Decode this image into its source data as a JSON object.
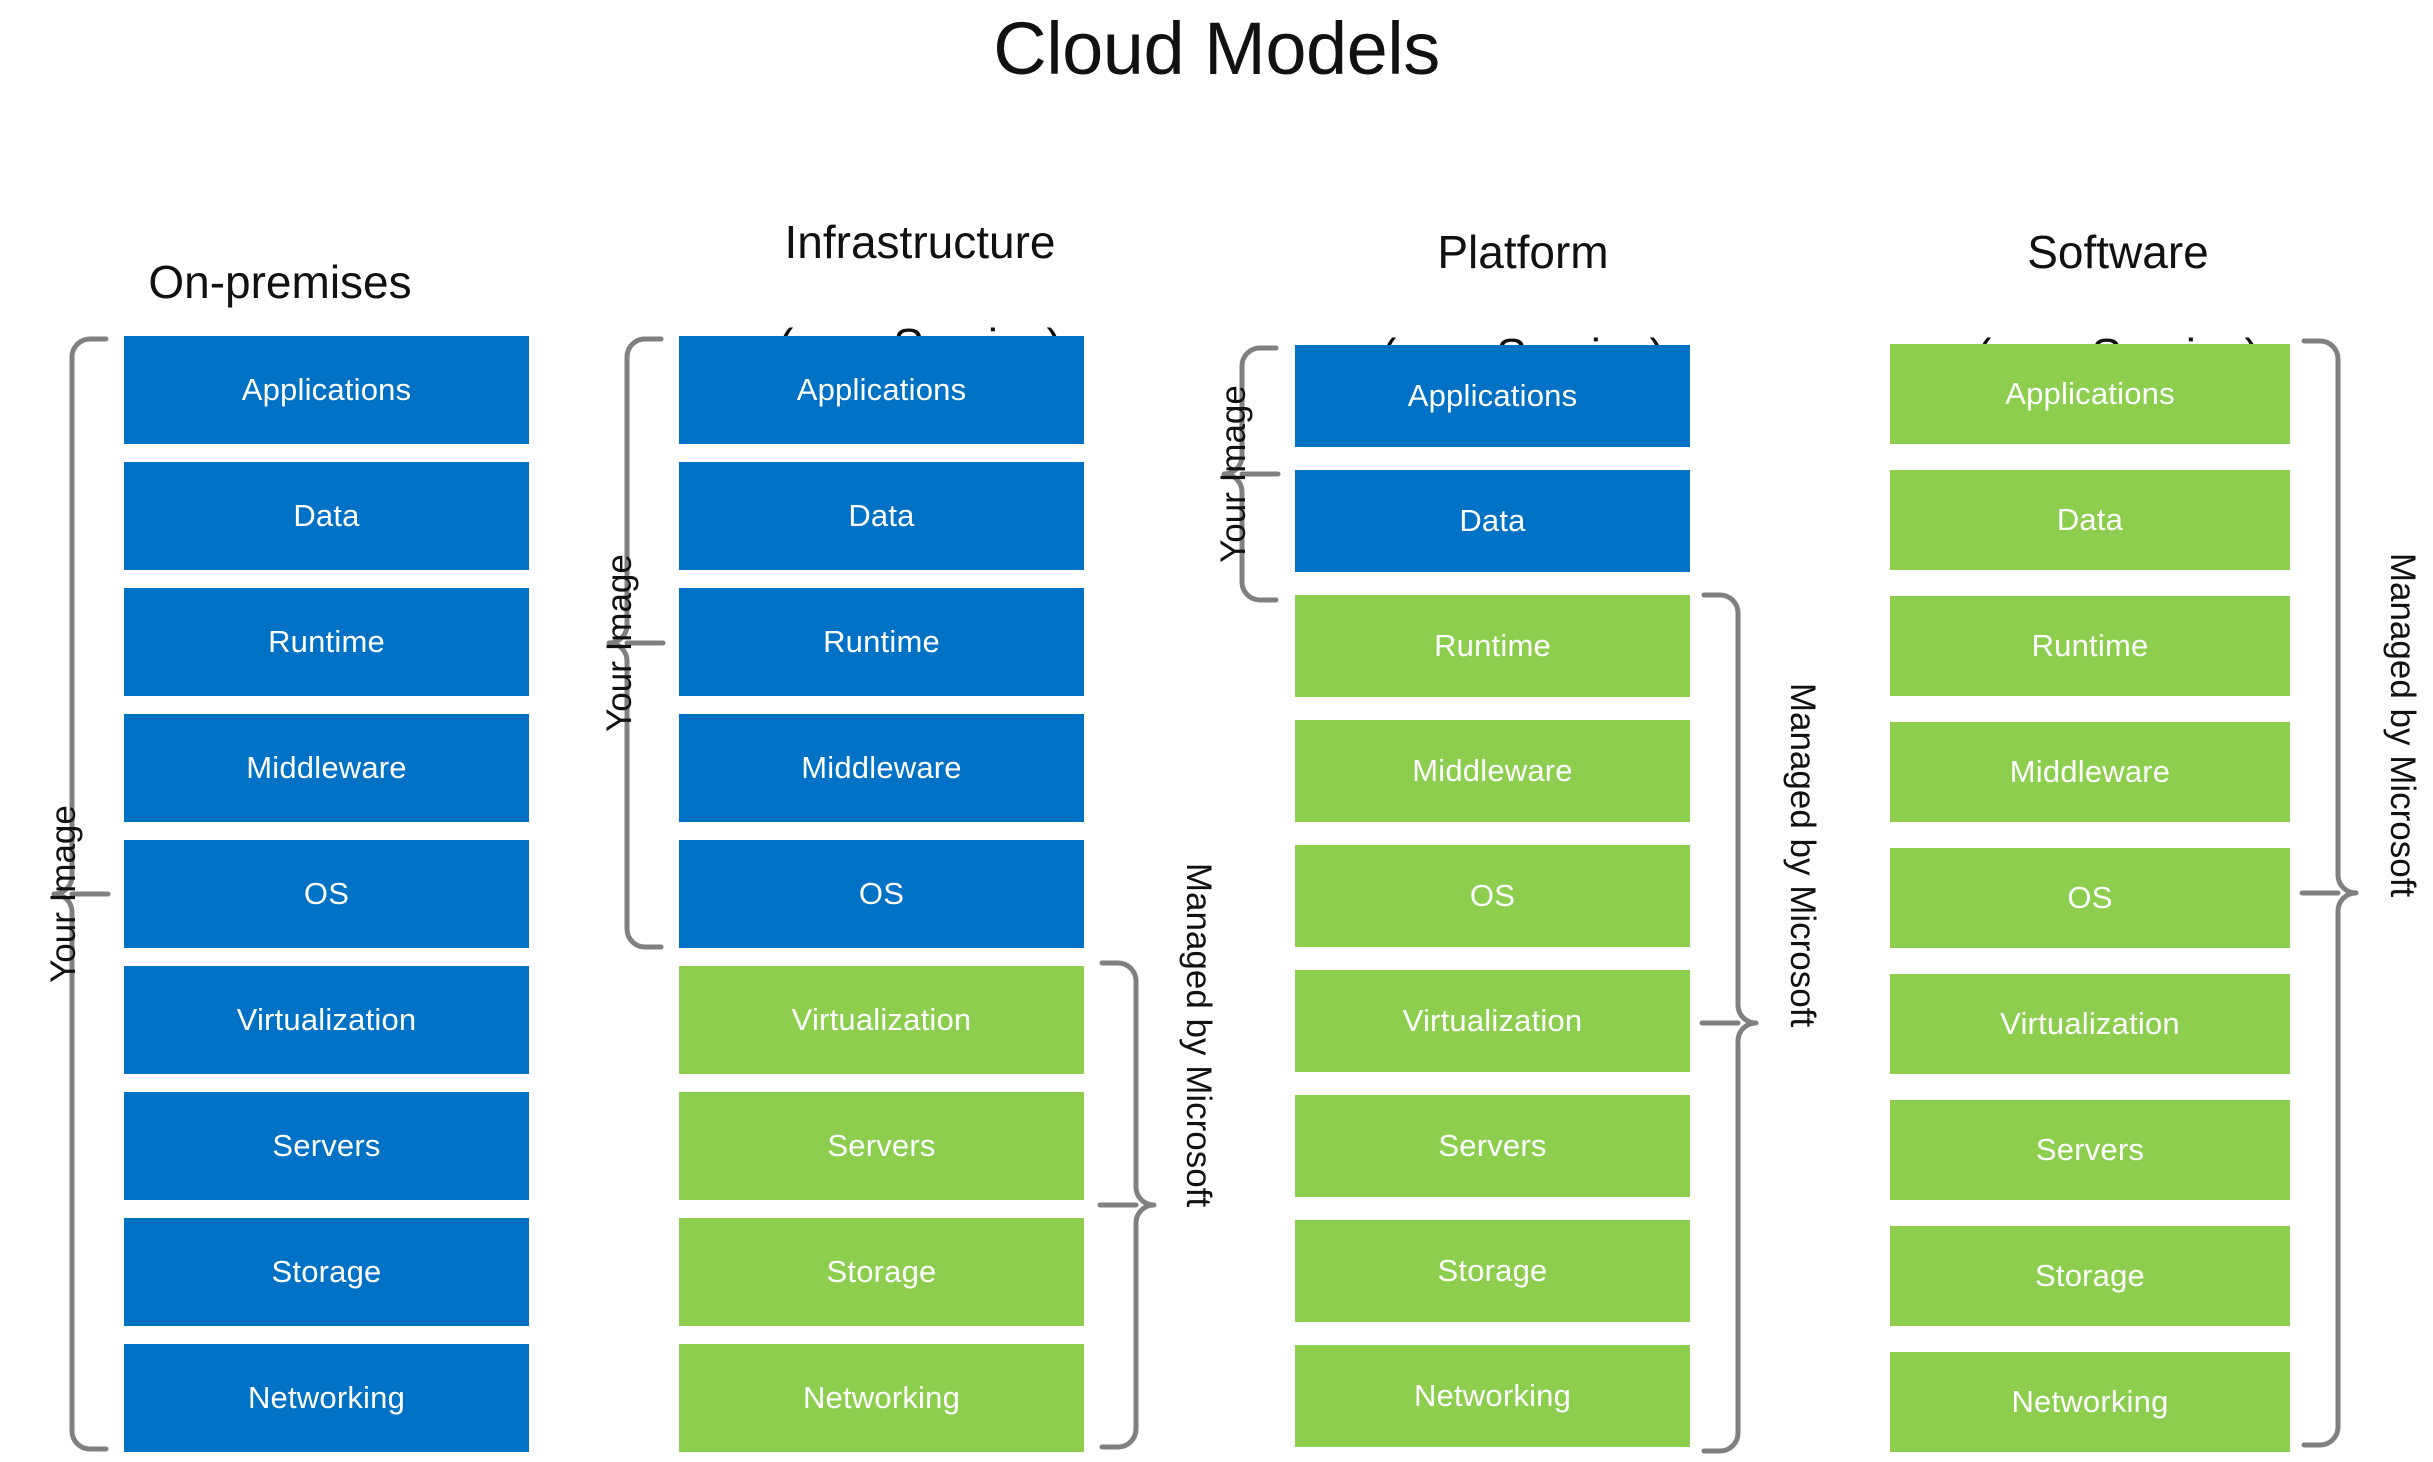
{
  "title": "Cloud Models",
  "colors": {
    "customer_managed": "#0072c6",
    "provider_managed": "#8dce4f",
    "brace": "#808080",
    "text_on_block": "#ffffff",
    "background": "#ffffff"
  },
  "layer_names": [
    "Applications",
    "Data",
    "Runtime",
    "Middleware",
    "OS",
    "Virtualization",
    "Servers",
    "Storage",
    "Networking"
  ],
  "brace_labels": {
    "customer": "Your Image",
    "provider": "Managed by Microsoft"
  },
  "columns": [
    {
      "id": "on-premises",
      "title_line1": "On-premises",
      "title_line2": "",
      "layers": [
        {
          "label": "Applications",
          "owner": "customer"
        },
        {
          "label": "Data",
          "owner": "customer"
        },
        {
          "label": "Runtime",
          "owner": "customer"
        },
        {
          "label": "Middleware",
          "owner": "customer"
        },
        {
          "label": "OS",
          "owner": "customer"
        },
        {
          "label": "Virtualization",
          "owner": "customer"
        },
        {
          "label": "Servers",
          "owner": "customer"
        },
        {
          "label": "Storage",
          "owner": "customer"
        },
        {
          "label": "Networking",
          "owner": "customer"
        }
      ],
      "customer_brace_label": "Your Image",
      "provider_brace_label": ""
    },
    {
      "id": "infrastructure-as-a-service",
      "title_line1": "Infrastructure",
      "title_line2": "(as a Service)",
      "layers": [
        {
          "label": "Applications",
          "owner": "customer"
        },
        {
          "label": "Data",
          "owner": "customer"
        },
        {
          "label": "Runtime",
          "owner": "customer"
        },
        {
          "label": "Middleware",
          "owner": "customer"
        },
        {
          "label": "OS",
          "owner": "customer"
        },
        {
          "label": "Virtualization",
          "owner": "provider"
        },
        {
          "label": "Servers",
          "owner": "provider"
        },
        {
          "label": "Storage",
          "owner": "provider"
        },
        {
          "label": "Networking",
          "owner": "provider"
        }
      ],
      "customer_brace_label": "Your Image",
      "provider_brace_label": "Managed by Microsoft"
    },
    {
      "id": "platform-as-a-service",
      "title_line1": "Platform",
      "title_line2": "(as a Service)",
      "layers": [
        {
          "label": "Applications",
          "owner": "customer"
        },
        {
          "label": "Data",
          "owner": "customer"
        },
        {
          "label": "Runtime",
          "owner": "provider"
        },
        {
          "label": "Middleware",
          "owner": "provider"
        },
        {
          "label": "OS",
          "owner": "provider"
        },
        {
          "label": "Virtualization",
          "owner": "provider"
        },
        {
          "label": "Servers",
          "owner": "provider"
        },
        {
          "label": "Storage",
          "owner": "provider"
        },
        {
          "label": "Networking",
          "owner": "provider"
        }
      ],
      "customer_brace_label": "Your Image",
      "provider_brace_label": "Managed by Microsoft"
    },
    {
      "id": "software-as-a-service",
      "title_line1": "Software",
      "title_line2": "(as a Service)",
      "layers": [
        {
          "label": "Applications",
          "owner": "provider"
        },
        {
          "label": "Data",
          "owner": "provider"
        },
        {
          "label": "Runtime",
          "owner": "provider"
        },
        {
          "label": "Middleware",
          "owner": "provider"
        },
        {
          "label": "OS",
          "owner": "provider"
        },
        {
          "label": "Virtualization",
          "owner": "provider"
        },
        {
          "label": "Servers",
          "owner": "provider"
        },
        {
          "label": "Storage",
          "owner": "provider"
        },
        {
          "label": "Networking",
          "owner": "provider"
        }
      ],
      "customer_brace_label": "",
      "provider_brace_label": "Managed by Microsoft"
    }
  ]
}
